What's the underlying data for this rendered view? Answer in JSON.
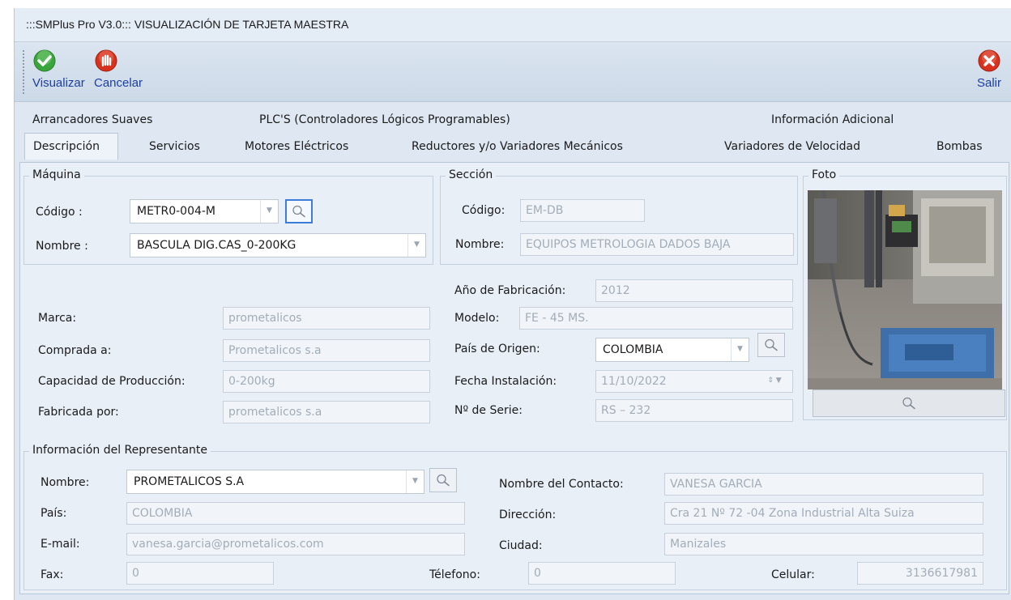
{
  "window": {
    "title": ":::SMPlus Pro V3.0::: VISUALIZACIÓN DE TARJETA MAESTRA"
  },
  "toolbar": {
    "visualizar_label": "Visualizar",
    "cancelar_label": "Cancelar",
    "salir_label": "Salir",
    "colors": {
      "ok": "#3aa53a",
      "cancel": "#d8321e",
      "exit": "#d8321e"
    }
  },
  "tabs": {
    "row1": [
      "Arrancadores Suaves",
      "PLC'S (Controladores Lógicos Programables)",
      "Información Adicional"
    ],
    "row2": [
      "Descripción",
      "Servicios",
      "Motores Eléctricos",
      "Reductores y/o Variadores Mecánicos",
      "Variadores de Velocidad",
      "Bombas"
    ],
    "active": "Descripción"
  },
  "maquina": {
    "legend": "Máquina",
    "codigo_label": "Código :",
    "codigo_value": "METR0-004-M",
    "nombre_label": "Nombre :",
    "nombre_value": "BASCULA DIG.CAS_0-200KG"
  },
  "seccion": {
    "legend": "Sección",
    "codigo_label": "Código:",
    "codigo_value": "EM-DB",
    "nombre_label": "Nombre:",
    "nombre_value": "EQUIPOS METROLOGIA DADOS BAJA"
  },
  "foto": {
    "legend": "Foto"
  },
  "detalles": {
    "anio_label": "Año de Fabricación:",
    "anio_value": "2012",
    "marca_label": "Marca:",
    "marca_value": "prometalicos",
    "modelo_label": "Modelo:",
    "modelo_value": "FE - 45 MS.",
    "comprada_label": "Comprada a:",
    "comprada_value": "Prometalicos s.a",
    "pais_origen_label": "País de Origen:",
    "pais_origen_value": "COLOMBIA",
    "capacidad_label": "Capacidad de Producción:",
    "capacidad_value": "0-200kg",
    "fecha_label": "Fecha Instalación:",
    "fecha_value": "11/10/2022",
    "fabricada_label": "Fabricada por:",
    "fabricada_value": "prometalicos s.a",
    "serie_label": "Nº de Serie:",
    "serie_value": "RS – 232"
  },
  "representante": {
    "legend": "Información del Representante",
    "nombre_label": "Nombre:",
    "nombre_value": "PROMETALICOS S.A",
    "contacto_label": "Nombre del  Contacto:",
    "contacto_value": "VANESA GARCIA",
    "pais_label": "País:",
    "pais_value": "COLOMBIA",
    "direccion_label": "Dirección:",
    "direccion_value": "Cra 21 Nº 72 -04 Zona Industrial Alta Suiza",
    "email_label": "E-mail:",
    "email_value": "vanesa.garcia@prometalicos.com",
    "ciudad_label": "Ciudad:",
    "ciudad_value": "Manizales",
    "fax_label": "Fax:",
    "fax_value": "0",
    "telefono_label": "Télefono:",
    "telefono_value": "0",
    "celular_label": "Celular:",
    "celular_value": "3136617981"
  }
}
